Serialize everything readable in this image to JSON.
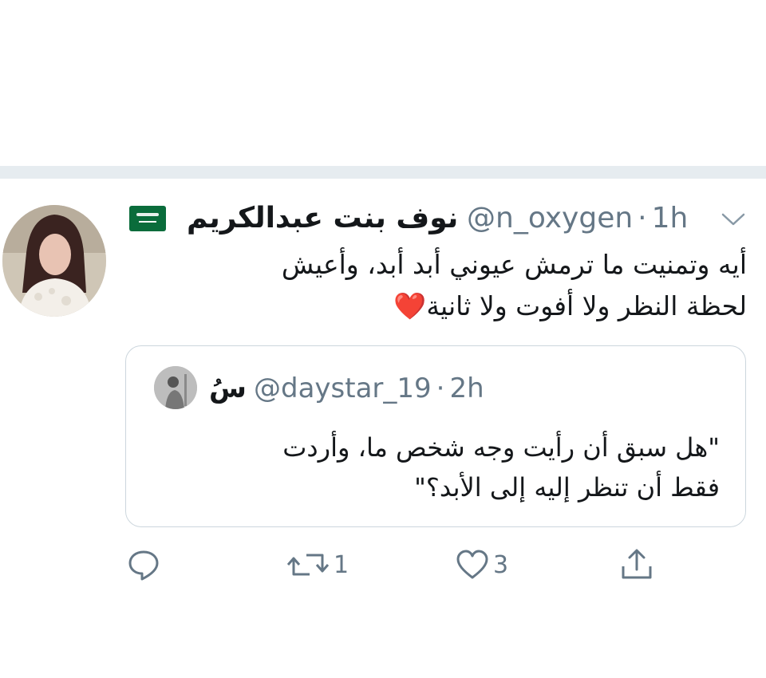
{
  "tweet": {
    "author_name": "نوف بنت عبدالكريم",
    "handle": "@n_oxygen",
    "separator": "·",
    "time": "1h",
    "flag_icon": "saudi-flag-icon",
    "text_line1": "أيه وتمنيت ما ترمش عيوني أبد أبد، وأعيش",
    "text_line2": "لحظة النظر ولا أفوت ولا ثانية",
    "emoji": "❤️"
  },
  "quoted_tweet": {
    "author_name": "سُ",
    "handle": "@daystar_19",
    "separator": "·",
    "time": "2h",
    "text_line1": "\"هل سبق أن رأيت وجه شخص ما، وأردت",
    "text_line2": "فقط أن تنظر إليه إلى الأبد؟\""
  },
  "actions": {
    "reply_icon": "reply-icon",
    "retweet_icon": "retweet-icon",
    "retweet_count": "1",
    "like_icon": "heart-icon",
    "like_count": "3",
    "share_icon": "share-icon"
  },
  "colors": {
    "text": "#14171a",
    "secondary": "#657786",
    "divider": "#e6ecf0",
    "border": "#ccd6dd",
    "heart": "#d0021b",
    "flag_green": "#0a6c3b"
  }
}
